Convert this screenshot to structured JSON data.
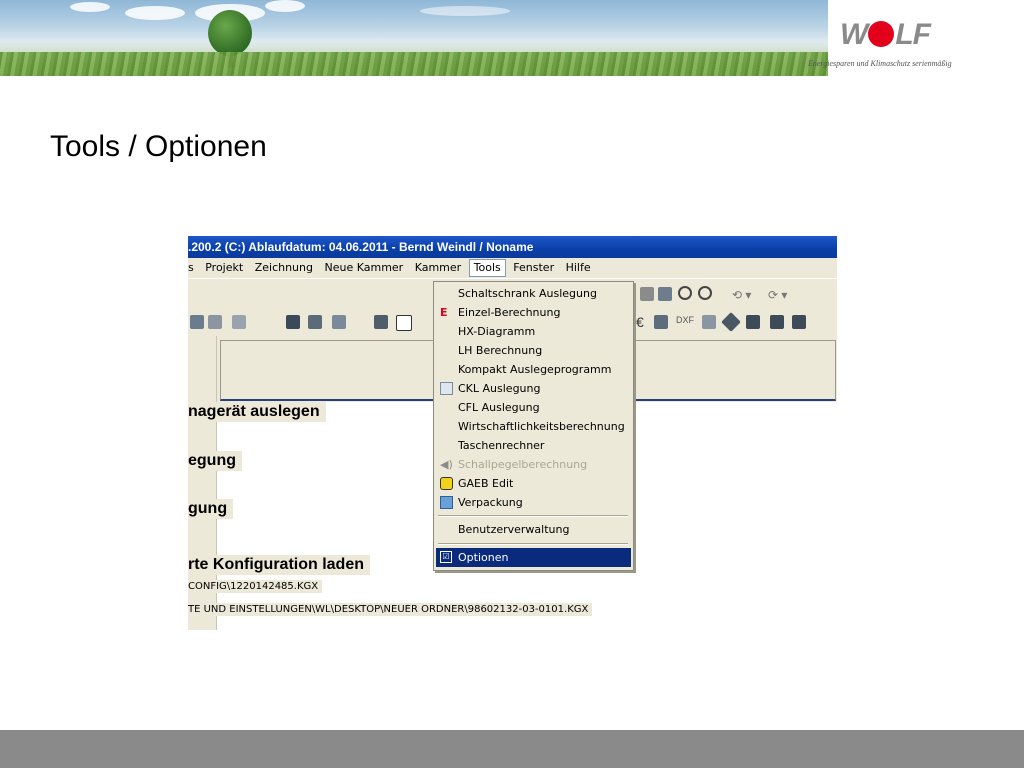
{
  "header": {
    "logo_text_left": "W",
    "logo_text_right": "LF",
    "tagline": "Energiesparen und Klimaschutz serienmäßig"
  },
  "slide": {
    "title": "Tools / Optionen"
  },
  "app": {
    "window_title": ".200.2 (C:) Ablaufdatum: 04.06.2011 - Bernd Weindl / Noname",
    "menu": [
      "s",
      "Projekt",
      "Zeichnung",
      "Neue Kammer",
      "Kammer",
      "Tools",
      "Fenster",
      "Hilfe"
    ],
    "sections": [
      "nagerät auslegen",
      "egung",
      "gung",
      "rte Konfiguration laden"
    ],
    "paths": [
      "CONFIG\\1220142485.KGX",
      "TE UND EINSTELLUNGEN\\WL\\DESKTOP\\NEUER ORDNER\\98602132-03-0101.KGX"
    ]
  },
  "tools_menu": {
    "items": [
      {
        "label": "Schaltschrank Auslegung",
        "icon": "none"
      },
      {
        "label": "Einzel-Berechnung",
        "icon": "wolf-e-icon"
      },
      {
        "label": "HX-Diagramm",
        "icon": "none"
      },
      {
        "label": "LH Berechnung",
        "icon": "none"
      },
      {
        "label": "Kompakt Auslegeprogramm",
        "icon": "none"
      },
      {
        "label": "CKL Auslegung",
        "icon": "calendar-icon"
      },
      {
        "label": "CFL Auslegung",
        "icon": "none"
      },
      {
        "label": "Wirtschaftlichkeitsberechnung",
        "icon": "none"
      },
      {
        "label": "Taschenrechner",
        "icon": "none"
      },
      {
        "label": "Schallpegelberechnung",
        "icon": "speaker-icon",
        "disabled": true
      },
      {
        "label": "GAEB Edit",
        "icon": "gaeb-icon"
      },
      {
        "label": "Verpackung",
        "icon": "package-icon"
      }
    ],
    "admin_item": "Benutzerverwaltung",
    "selected_item": "Optionen"
  },
  "colors": {
    "titlebar": "#0a3fa8",
    "menu_bg": "#ece9d8",
    "selection": "#0a2a7e",
    "footer": "#8a8a8a",
    "logo_red": "#e3001b"
  }
}
